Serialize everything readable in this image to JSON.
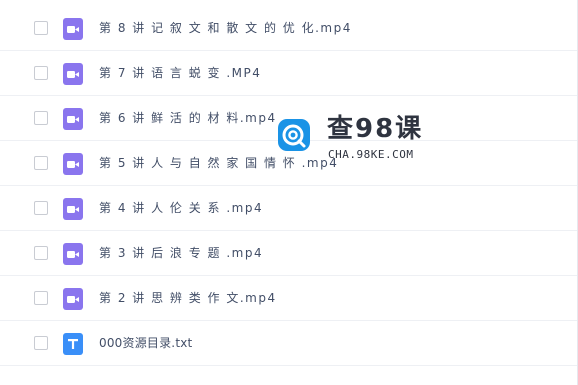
{
  "files": [
    {
      "name": "第 8 讲 记 叙 文 和 散 文 的 优 化.mp4",
      "type": "video",
      "icon": "video-file-icon"
    },
    {
      "name": "第 7 讲 语 言 蜕 变 .MP4",
      "type": "video",
      "icon": "video-file-icon"
    },
    {
      "name": "第 6 讲 鲜 活 的 材 料.mp4",
      "type": "video",
      "icon": "video-file-icon"
    },
    {
      "name": "第 5 讲 人 与 自 然 家 国 情 怀 .mp4",
      "type": "video",
      "icon": "video-file-icon"
    },
    {
      "name": "第 4 讲 人 伦 关 系 .mp4",
      "type": "video",
      "icon": "video-file-icon"
    },
    {
      "name": "第 3 讲 后 浪 专 题 .mp4",
      "type": "video",
      "icon": "video-file-icon"
    },
    {
      "name": "第 2 讲 思 辨 类 作 文.mp4",
      "type": "video",
      "icon": "video-file-icon"
    },
    {
      "name": "000资源目录.txt",
      "type": "text",
      "icon": "text-file-icon"
    }
  ],
  "watermark": {
    "title": "查98课",
    "subtitle": "CHA.98KE.COM",
    "icon": "watermark-logo-icon"
  },
  "colors": {
    "video_icon": "#8a75ee",
    "text_icon": "#3a8ff8",
    "logo_blue": "#1a93e6",
    "text": "#424e67"
  }
}
